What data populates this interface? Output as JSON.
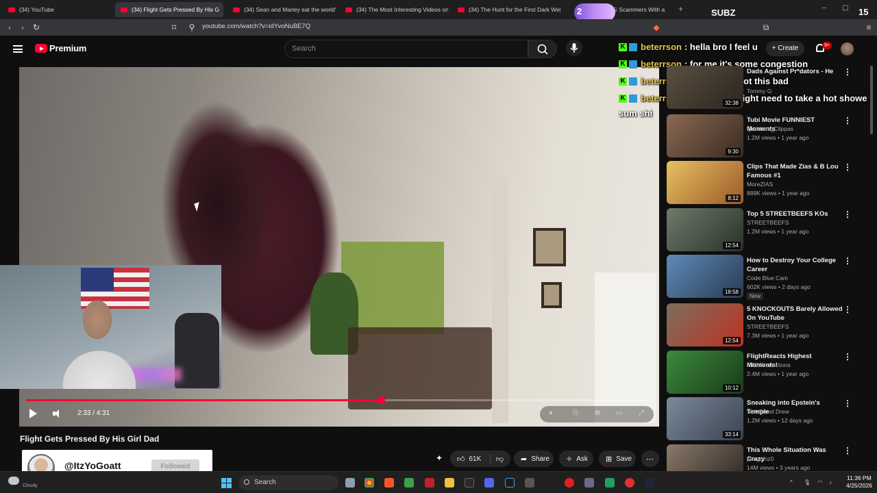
{
  "browser": {
    "tabs": [
      {
        "title": "(34) YouTube"
      },
      {
        "title": "(34) Flight Gets Pressed By His G",
        "active": true
      },
      {
        "title": "(34) Sean and Marley eat the world's"
      },
      {
        "title": "(34) The Most Interesting Videos on"
      },
      {
        "title": "(34) The Hunt for the First Dark Web"
      },
      {
        "title": "NG Scammers With a"
      }
    ],
    "url": "youtube.com/watch?v=idYvoNuBE7Q"
  },
  "youtube": {
    "logo_text": "Premium",
    "search_placeholder": "Search",
    "create_label": "Create",
    "notif_badge": "9+"
  },
  "player": {
    "current_time": "2:33",
    "duration": "4:31",
    "time_display": "2:33 / 4:31",
    "progress_fraction": 0.566
  },
  "video": {
    "title": "Flight Gets Pressed By His Girl Dad",
    "like_count": "61K",
    "share_label": "Share",
    "ask_label": "Ask",
    "save_label": "Save"
  },
  "follow_banner": {
    "handle": "@ItzYoGoatt",
    "button_label": "Followed"
  },
  "subz_overlay": {
    "count": "2",
    "label": "SUBZ",
    "right_number": "15"
  },
  "chat": [
    {
      "user": "beterrson",
      "message": ": hella bro I feel u"
    },
    {
      "user": "beterrson",
      "message": ": for me it's some congestion"
    },
    {
      "user": "beterrson",
      "message": ": it's usually not this bad"
    },
    {
      "user": "beterrson",
      "message": ": hella bro I might need to take a hot showe"
    },
    {
      "user": "",
      "message": "sum shi"
    }
  ],
  "recommendations": [
    {
      "title": "Dads Against Pr*dators - He",
      "channel": "Tommy G",
      "meta": "",
      "duration": "32:38",
      "thumb_colors": [
        "#5a5040",
        "#2c2420"
      ]
    },
    {
      "title": "Tubi Movie FUNNIEST Moments",
      "channel": "Quantum_Clippas",
      "meta": "1.2M views • 1 year ago",
      "duration": "9:30",
      "thumb_colors": [
        "#8a6a52",
        "#3a2a22"
      ]
    },
    {
      "title": "Clips That Made Zias & B Lou Famous #1",
      "channel": "MoreZIAS",
      "meta": "888K views • 1 year ago",
      "duration": "8:12",
      "thumb_colors": [
        "#e8c060",
        "#9a5a2a"
      ]
    },
    {
      "title": "Top 5 STREETBEEFS KOs",
      "channel": "STREETBEEFS",
      "meta": "1.2M views • 1 year ago",
      "duration": "12:54",
      "thumb_colors": [
        "#6e7a6a",
        "#2a3228"
      ]
    },
    {
      "title": "How to Destroy Your College Career",
      "channel": "Code Blue Cam",
      "meta": "602K views • 2 days ago",
      "badge": "New",
      "duration": "18:58",
      "thumb_colors": [
        "#5e8ab8",
        "#2a3a52"
      ]
    },
    {
      "title": "5 KNOCKOUTS Barely Allowed On YouTube",
      "channel": "STREETBEEFS",
      "meta": "7.3M views • 1 year ago",
      "duration": "12:54",
      "thumb_colors": [
        "#7a7060",
        "#c03020"
      ]
    },
    {
      "title": "FlightReacts Highest Moments!",
      "channel": "FTC Productions",
      "meta": "2.4M views • 1 year ago",
      "duration": "10:12",
      "thumb_colors": [
        "#3a8a3a",
        "#1a3a1a"
      ]
    },
    {
      "title": "Sneaking into Epstein's Temple",
      "channel": "SideQuest Drew",
      "meta": "1.2M views • 12 days ago",
      "duration": "33:14",
      "thumb_colors": [
        "#7a8a9a",
        "#3a4250"
      ]
    },
    {
      "title": "This Whole Situation Was Crazy",
      "channel": "penguinz0",
      "meta": "14M views • 3 years ago",
      "duration": "",
      "thumb_colors": [
        "#8a7a6a",
        "#2a2420"
      ]
    }
  ],
  "taskbar": {
    "search_label": "Search",
    "weather_text": "Cloudy",
    "time": "11:36 PM",
    "date": "4/25/2026"
  },
  "colors": {
    "accent_red": "#ff0033",
    "kick_green": "#53fc18",
    "chat_username": "#e9c84d"
  }
}
